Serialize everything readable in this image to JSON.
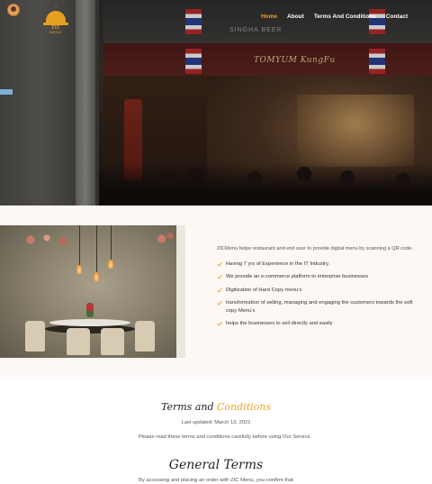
{
  "brand": {
    "logo_name": "ZIC",
    "logo_sub": "MENU"
  },
  "nav": {
    "items": [
      "Home",
      "About",
      "Terms And Conditions",
      "Contact"
    ],
    "active": "Home"
  },
  "hero": {
    "sign_text": "TOMYUM KungFu",
    "sign_top_text": "SINGHA BEER"
  },
  "about": {
    "intro": "ZICMenu helps restaurant and end user to provide digital menu by scanning a QR code.",
    "points": [
      "Having 7 yrs of Experience in the IT Industry.",
      "We provide an e-commerce platform to enterprise businesses",
      "Digitization of Hard Copy menu's",
      "transformation of selling, managing and engaging the customers towards the soft copy Menu's",
      "helps the businesses to sell directly and easily"
    ]
  },
  "terms": {
    "title_part1": "Terms and",
    "title_part2": "Conditions",
    "updated": "Last updated: March 13, 2021",
    "read_notice": "Please read these terms and conditions carefully before using Our Service.",
    "general_title": "General Terms",
    "accept_text": "By accessing and placing an order with ZIC Menu, you confirm that"
  },
  "colors": {
    "accent": "#f2a324",
    "check": "#e8a020",
    "about_bg": "#fdf8f3"
  }
}
